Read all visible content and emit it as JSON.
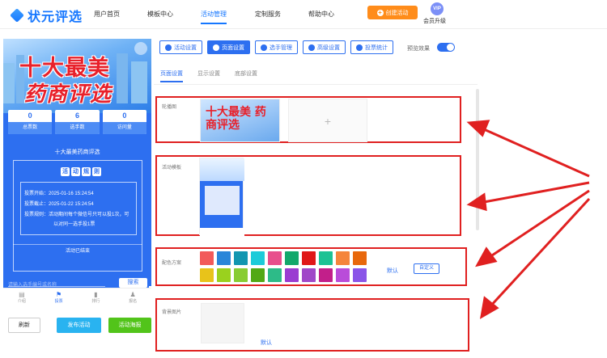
{
  "header": {
    "logo_text": "状元评选",
    "nav": [
      "用户首页",
      "模板中心",
      "活动管理",
      "定制服务",
      "帮助中心"
    ],
    "create_label": "创建活动",
    "vip_badge": "VIP",
    "vip_label": "会员升级"
  },
  "preview": {
    "banner_line1": "十大最美",
    "banner_line2": "药商评选",
    "stats": [
      {
        "value": "0",
        "label": "总票数"
      },
      {
        "value": "6",
        "label": "选手数"
      },
      {
        "value": "0",
        "label": "访问量"
      }
    ],
    "title": "十大最美药商评选",
    "rule_heading": [
      "活",
      "动",
      "规",
      "则"
    ],
    "rules": [
      "投票开始：2025-01-16 15:24:54",
      "投票截止：2025-01-22 15:24:54",
      "投票规则：活动期间每个微信号只可以投1次，可",
      "以对同一选手投1票"
    ],
    "ended_text": "活动已结束",
    "search_placeholder": "请输入选手编号或名称",
    "search_button": "搜索",
    "tabbar": [
      {
        "icon": "▤",
        "label": "介绍"
      },
      {
        "icon": "⚑",
        "label": "投票"
      },
      {
        "icon": "▮",
        "label": "排行"
      },
      {
        "icon": "♟",
        "label": "报名"
      }
    ],
    "buttons": {
      "refresh": "刷新",
      "publish": "发布活动",
      "poster": "活动海报"
    }
  },
  "settings": {
    "tabs": [
      "活动设置",
      "页面设置",
      "选手管理",
      "高级设置",
      "投票统计"
    ],
    "active_tab": "页面设置",
    "preview_effect_label": "预览效果",
    "preview_enabled": true,
    "subtabs": [
      "页面设置",
      "显示设置",
      "底部设置"
    ],
    "active_subtab": "页面设置",
    "carousel_label": "轮播图",
    "carousel_image_text": "十大最美 药商评选",
    "template_label": "活动模板",
    "color_label": "配色方案",
    "default_label": "默认",
    "custom_label": "自定义",
    "colors_row1": [
      "#f25a5a",
      "#2a86d9",
      "#1296b0",
      "#1dcbd9",
      "#e84f8c",
      "#12a86b",
      "#e01818",
      "#1cc294",
      "#f5853c",
      "#e8680c"
    ],
    "colors_row2": [
      "#e8c31a",
      "#9ad11e",
      "#88cc33",
      "#52a815",
      "#2dbb88",
      "#9a3cd1",
      "#a048c8",
      "#c21f8a",
      "#b94cd9",
      "#8a55e8"
    ],
    "background_label": "背景图片",
    "background_default": "默认"
  }
}
